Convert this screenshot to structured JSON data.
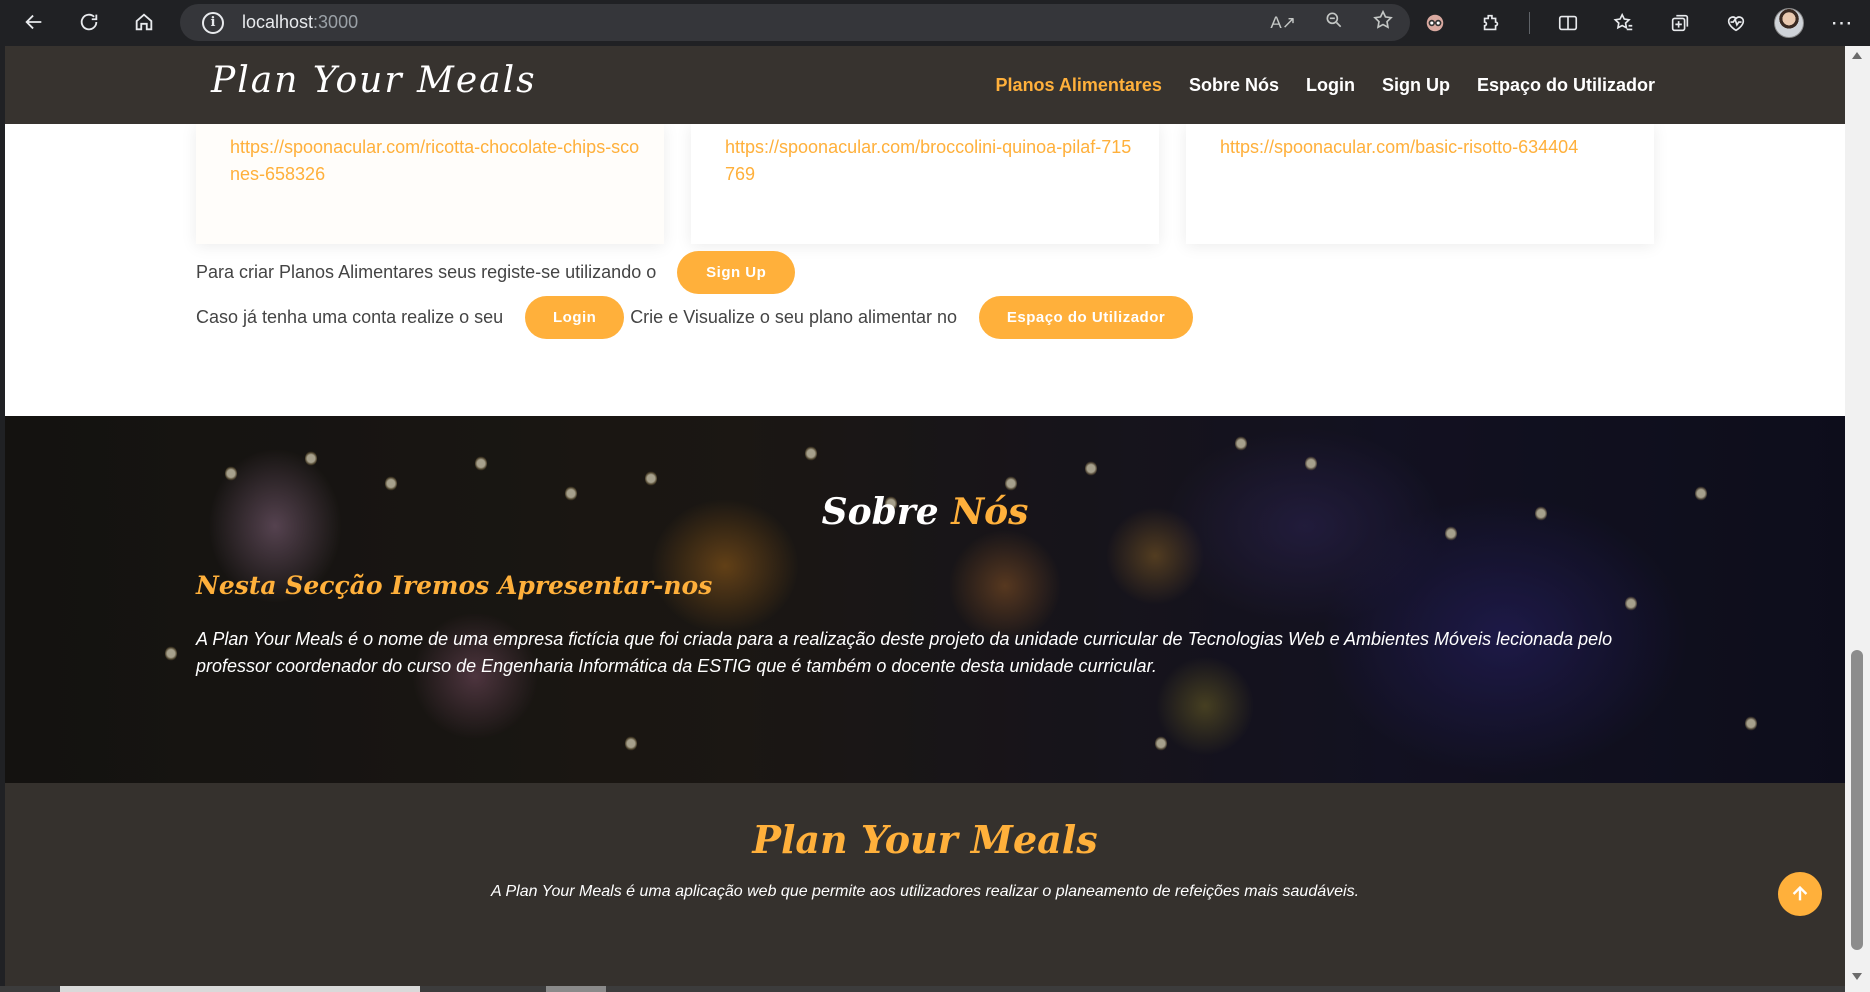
{
  "browser": {
    "url_host": "localhost",
    "url_port": ":3000",
    "read_aloud_glyph": "A↗"
  },
  "site": {
    "logo": "Plan Your Meals",
    "nav": [
      {
        "label": "Planos Alimentares"
      },
      {
        "label": "Sobre Nós"
      },
      {
        "label": "Login"
      },
      {
        "label": "Sign Up"
      },
      {
        "label": "Espaço do Utilizador"
      }
    ]
  },
  "cards": [
    {
      "link": "https://spoonacular.com/ricotta-chocolate-chips-scones-658326"
    },
    {
      "link": "https://spoonacular.com/broccolini-quinoa-pilaf-715769"
    },
    {
      "link": "https://spoonacular.com/basic-risotto-634404"
    }
  ],
  "cta": {
    "signup_text": "Para criar Planos Alimentares seus registe-se utilizando o",
    "signup_button": "Sign Up",
    "login_text": "Caso já tenha uma conta realize o seu",
    "login_button": "Login",
    "space_text": "Crie e Visualize o seu plano alimentar no",
    "space_button": "Espaço do Utilizador"
  },
  "about": {
    "title_part1": "Sobre",
    "title_part2": "Nós",
    "subtitle": "Nesta Secção Iremos Apresentar-nos",
    "text": "A Plan Your Meals é o nome de uma empresa fictícia que foi criada para a realização deste projeto da unidade curricular de Tecnologias Web e Ambientes Móveis lecionada pelo professor coordenador do curso de Engenharia Informática da ESTIG que é também o docente desta unidade curricular."
  },
  "footer": {
    "title": "Plan Your Meals",
    "text": "A Plan Your Meals é uma aplicação web que permite aos utilizadores realizar o planeamento de refeições mais saudáveis."
  },
  "colors": {
    "accent": "#ffb03b",
    "header_bg": "#37332f",
    "footer_bg": "#35312d"
  }
}
